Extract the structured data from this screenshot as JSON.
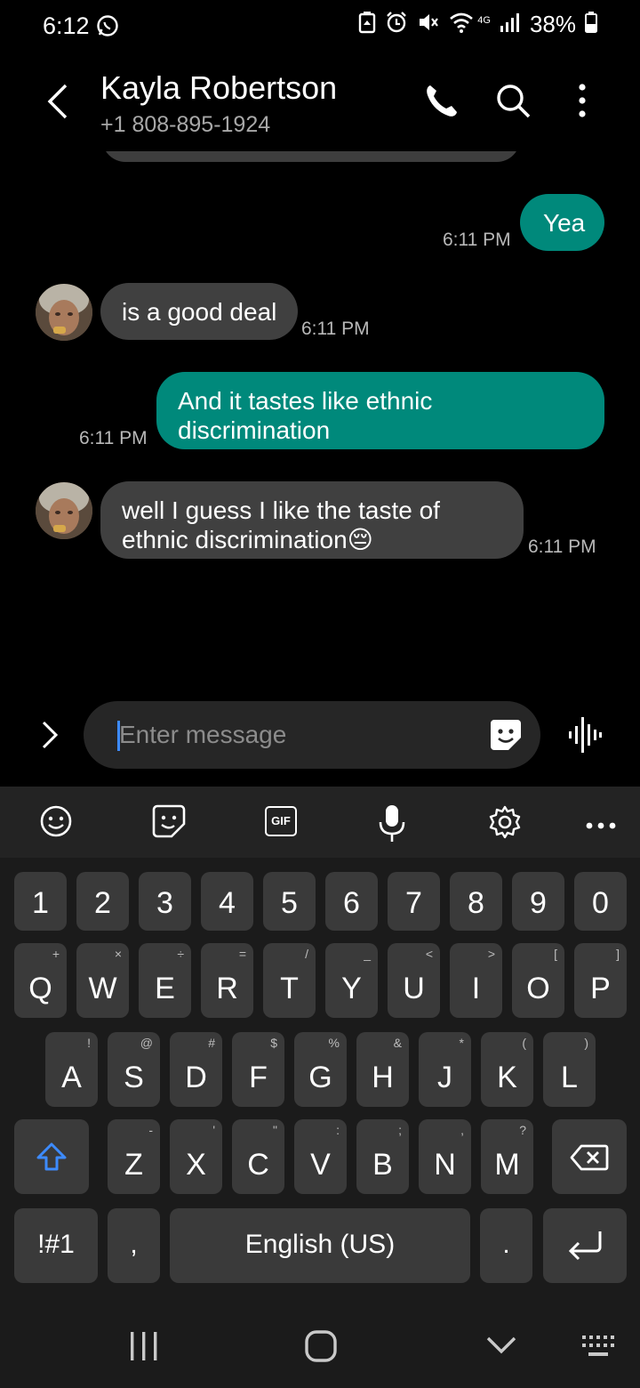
{
  "status_bar": {
    "time": "6:12",
    "battery": "38%",
    "network": "4G",
    "icons": [
      "whatsapp-icon",
      "battery-saver-icon",
      "alarm-icon",
      "mute-icon",
      "wifi-icon",
      "signal-icon",
      "battery-icon"
    ]
  },
  "header": {
    "contact_name": "Kayla Robertson",
    "phone": "+1 808-895-1924",
    "icons": [
      "back-icon",
      "phone-icon",
      "search-icon",
      "more-options-icon"
    ]
  },
  "messages": [
    {
      "direction": "outgoing",
      "text": "Yea",
      "time": "6:11 PM"
    },
    {
      "direction": "incoming",
      "text": "is a good deal",
      "time": "6:11 PM"
    },
    {
      "direction": "outgoing",
      "line1": "And it tastes like ethnic",
      "line2": "discrimination",
      "time": "6:11 PM"
    },
    {
      "direction": "incoming",
      "line1": "well I guess I like the taste of",
      "line2": "ethnic discrimination",
      "emoji": "😔",
      "time": "6:11 PM"
    }
  ],
  "composer": {
    "placeholder": "Enter message"
  },
  "keyboard": {
    "toolbar": [
      "emoji-icon",
      "sticker-icon",
      "gif-icon",
      "microphone-icon",
      "settings-icon",
      "more-icon"
    ],
    "gif_label": "GIF",
    "number_row": [
      "1",
      "2",
      "3",
      "4",
      "5",
      "6",
      "7",
      "8",
      "9",
      "0"
    ],
    "row_q": [
      {
        "k": "Q",
        "s": "+"
      },
      {
        "k": "W",
        "s": "×"
      },
      {
        "k": "E",
        "s": "÷"
      },
      {
        "k": "R",
        "s": "="
      },
      {
        "k": "T",
        "s": "/"
      },
      {
        "k": "Y",
        "s": "_"
      },
      {
        "k": "U",
        "s": "<"
      },
      {
        "k": "I",
        "s": ">"
      },
      {
        "k": "O",
        "s": "["
      },
      {
        "k": "P",
        "s": "]"
      }
    ],
    "row_a": [
      {
        "k": "A",
        "s": "!"
      },
      {
        "k": "S",
        "s": "@"
      },
      {
        "k": "D",
        "s": "#"
      },
      {
        "k": "F",
        "s": "$"
      },
      {
        "k": "G",
        "s": "%"
      },
      {
        "k": "H",
        "s": "&"
      },
      {
        "k": "J",
        "s": "*"
      },
      {
        "k": "K",
        "s": "("
      },
      {
        "k": "L",
        "s": ")"
      }
    ],
    "row_z": [
      {
        "k": "Z",
        "s": "-"
      },
      {
        "k": "X",
        "s": "'"
      },
      {
        "k": "C",
        "s": "\""
      },
      {
        "k": "V",
        "s": ":"
      },
      {
        "k": "B",
        "s": ";"
      },
      {
        "k": "N",
        "s": ","
      },
      {
        "k": "M",
        "s": "?"
      }
    ],
    "symbols_key": "!#1",
    "comma_key": ",",
    "space_label": "English (US)",
    "period_key": ".",
    "accent_color": "#3d8bff"
  },
  "colors": {
    "outgoing_bubble": "#00897b",
    "incoming_bubble": "#404040"
  }
}
